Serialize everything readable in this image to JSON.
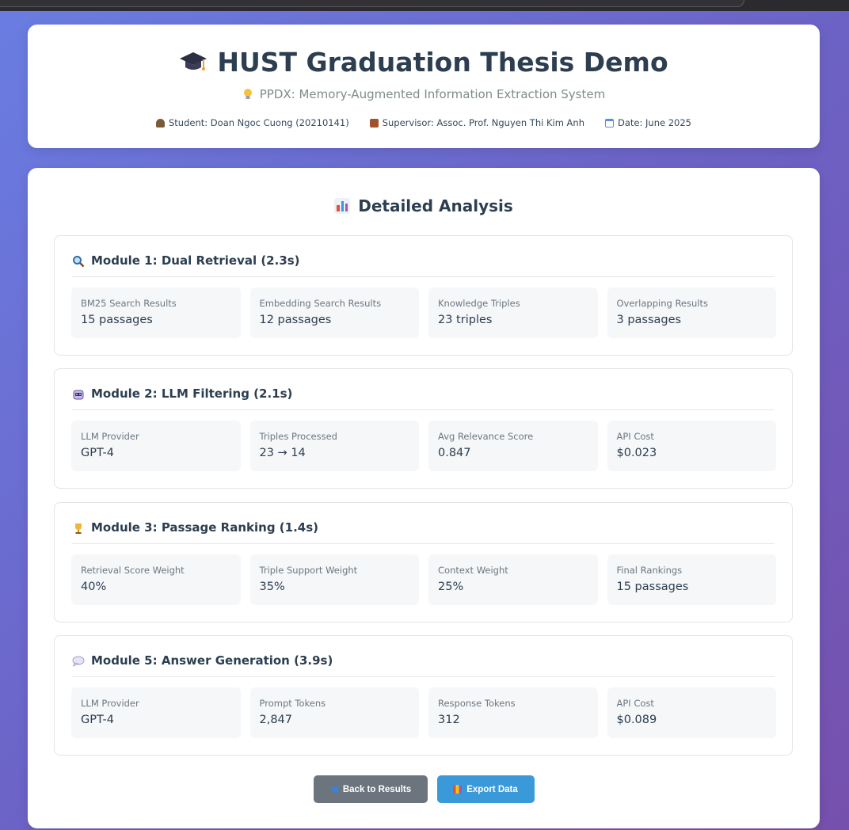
{
  "header": {
    "title": "HUST Graduation Thesis Demo",
    "title_icon": "graduation-cap-icon",
    "subtitle": "PPDX: Memory-Augmented Information Extraction System",
    "subtitle_icon": "lightbulb-icon",
    "student": "Student: Doan Ngoc Cuong (20210141)",
    "supervisor": "Supervisor: Assoc. Prof. Nguyen Thi Kim Anh",
    "date": "Date: June 2025"
  },
  "analysis": {
    "title": "Detailed Analysis",
    "modules": [
      {
        "title": "Module 1: Dual Retrieval (2.3s)",
        "icon": "magnifier-icon",
        "stats": [
          {
            "label": "BM25 Search Results",
            "value": "15 passages"
          },
          {
            "label": "Embedding Search Results",
            "value": "12 passages"
          },
          {
            "label": "Knowledge Triples",
            "value": "23 triples"
          },
          {
            "label": "Overlapping Results",
            "value": "3 passages"
          }
        ]
      },
      {
        "title": "Module 2: LLM Filtering (2.1s)",
        "icon": "robot-icon",
        "stats": [
          {
            "label": "LLM Provider",
            "value": "GPT-4"
          },
          {
            "label": "Triples Processed",
            "value": "23 → 14"
          },
          {
            "label": "Avg Relevance Score",
            "value": "0.847"
          },
          {
            "label": "API Cost",
            "value": "$0.023"
          }
        ]
      },
      {
        "title": "Module 3: Passage Ranking (1.4s)",
        "icon": "trophy-icon",
        "stats": [
          {
            "label": "Retrieval Score Weight",
            "value": "40%"
          },
          {
            "label": "Triple Support Weight",
            "value": "35%"
          },
          {
            "label": "Context Weight",
            "value": "25%"
          },
          {
            "label": "Final Rankings",
            "value": "15 passages"
          }
        ]
      },
      {
        "title": "Module 5: Answer Generation (3.9s)",
        "icon": "speech-bubble-icon",
        "stats": [
          {
            "label": "LLM Provider",
            "value": "GPT-4"
          },
          {
            "label": "Prompt Tokens",
            "value": "2,847"
          },
          {
            "label": "Response Tokens",
            "value": "312"
          },
          {
            "label": "API Cost",
            "value": "$0.089"
          }
        ]
      }
    ]
  },
  "actions": {
    "back_label": "Back to Results",
    "export_label": "Export Data"
  },
  "colors": {
    "background_start": "#6a7de2",
    "background_end": "#7650ad",
    "back_button": "#6c757d",
    "export_button": "#3a9ad9",
    "title_text": "#2c3e50"
  }
}
